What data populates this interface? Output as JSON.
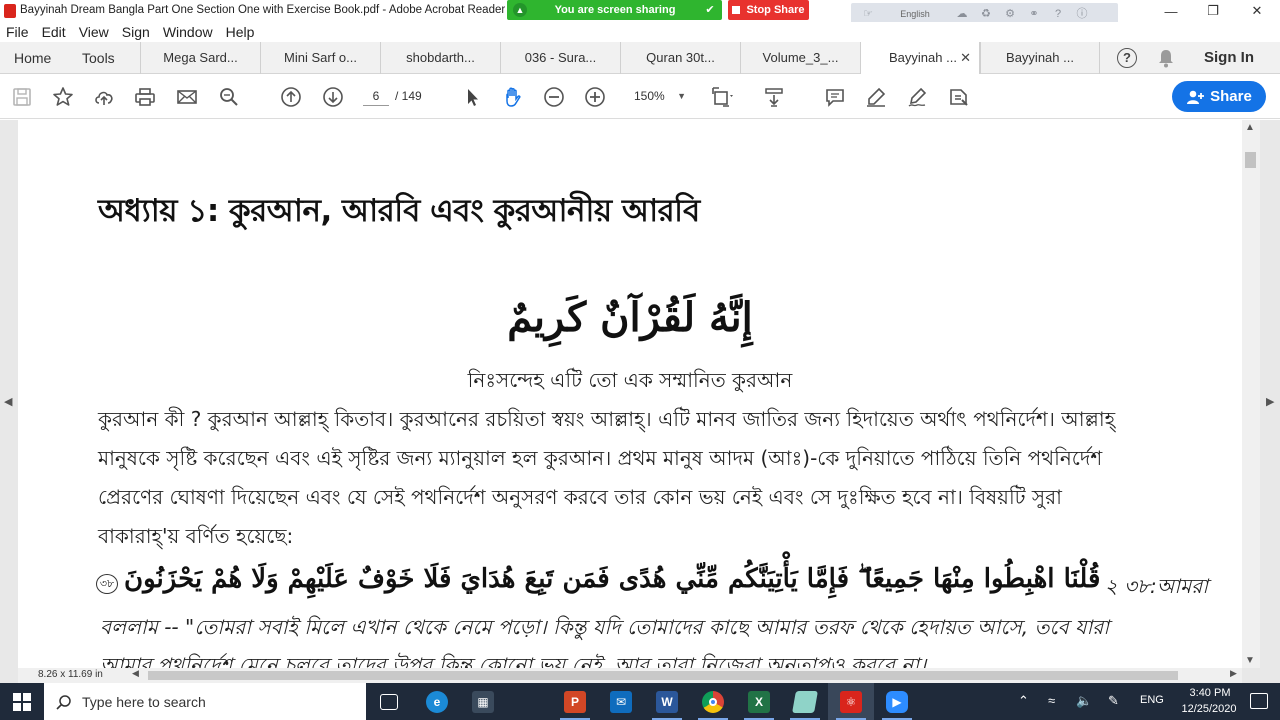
{
  "window": {
    "title": "Bayyinah Dream Bangla Part One Section One with Exercise Book.pdf - Adobe Acrobat Reader DC"
  },
  "share": {
    "status": "You are screen sharing",
    "stop_label": "Stop Share"
  },
  "zoom_toolbar": {
    "language": "English"
  },
  "menu": [
    "File",
    "Edit",
    "View",
    "Sign",
    "Window",
    "Help"
  ],
  "tabs": {
    "home": "Home",
    "tools": "Tools",
    "docs": [
      "Mega Sard...",
      "Mini Sarf o...",
      "shobdarth...",
      "036 - Sura...",
      "Quran 30t...",
      "Volume_3_...",
      "Bayyinah ...",
      "Bayyinah ..."
    ],
    "active_index": 6,
    "sign_in": "Sign In"
  },
  "toolbar": {
    "page_current": "6",
    "page_total": "/ 149",
    "zoom": "150%",
    "share_label": "Share"
  },
  "document": {
    "chapter_title": "অধ্যায় ১: কুরআন, আরবি এবং কুরআনীয় আরবি",
    "verse_arabic": "إِنَّهُ لَقُرْآنٌ كَرِيمٌ",
    "verse_translation": "নিঃসন্দেহ এটি তো এক সম্মানিত কুরআন",
    "body_lines": [
      "কুরআন কী ? কুরআন আল্লাহ্‌ কিতাব। কুরআনের রচয়িতা স্বয়ং আল্লাহ্‌। এটি মানব জাতির জন্য হিদায়েত অর্থাৎ পথনির্দেশ। আল্লাহ্‌",
      "মানুষকে সৃষ্টি করেছেন এবং এই সৃষ্টির জন্য ম্যানুয়াল হল কুরআন। প্রথম মানুষ আদম (আঃ)-কে দুনিয়াতে পাঠিয়ে তিনি পথনির্দেশ",
      "প্রেরণের ঘোষণা দিয়েছেন এবং যে সেই পথনির্দেশ অনুসরণ করবে তার কোন ভয় নেই এবং সে দুঃক্ষিত হবে না। বিষয়টি সুরা",
      "বাকারাহ্‌'য় বর্ণিত হয়েছে:"
    ],
    "ayah_number": "৩৮",
    "ayah_arabic": "قُلْنَا اهْبِطُوا مِنْهَا جَمِيعًا ۖ فَإِمَّا يَأْتِيَنَّكُم مِّنِّي هُدًى فَمَن تَبِعَ هُدَايَ فَلَا خَوْفٌ عَلَيْهِمْ وَلَا هُمْ يَحْزَنُونَ",
    "ayah_ref": "২ ৩৮:আমরা",
    "translation_lines": [
      "বললাম -- \"তোমরা সবাই মিলে এখান থেকে নেমে পড়ো। কিন্তু যদি তোমাদের কাছে আমার তরফ থেকে হেদায়ত আসে, তবে যারা",
      "আমার পথনির্দেশ মেনে চলবে তাদের উপর কিন্তু কোনো ভয় নেই, আর তারা নিজেরা অনুতাপও করবে না।"
    ],
    "page_size": "8.26 x 11.69 in"
  },
  "taskbar": {
    "search_placeholder": "Type here to search",
    "language": "ENG",
    "time": "3:40 PM",
    "date": "12/25/2020"
  },
  "colors": {
    "accent": "#1473e6",
    "share_green": "#2fb52f",
    "stop_red": "#e8322e",
    "taskbar": "#1f2a3a"
  }
}
